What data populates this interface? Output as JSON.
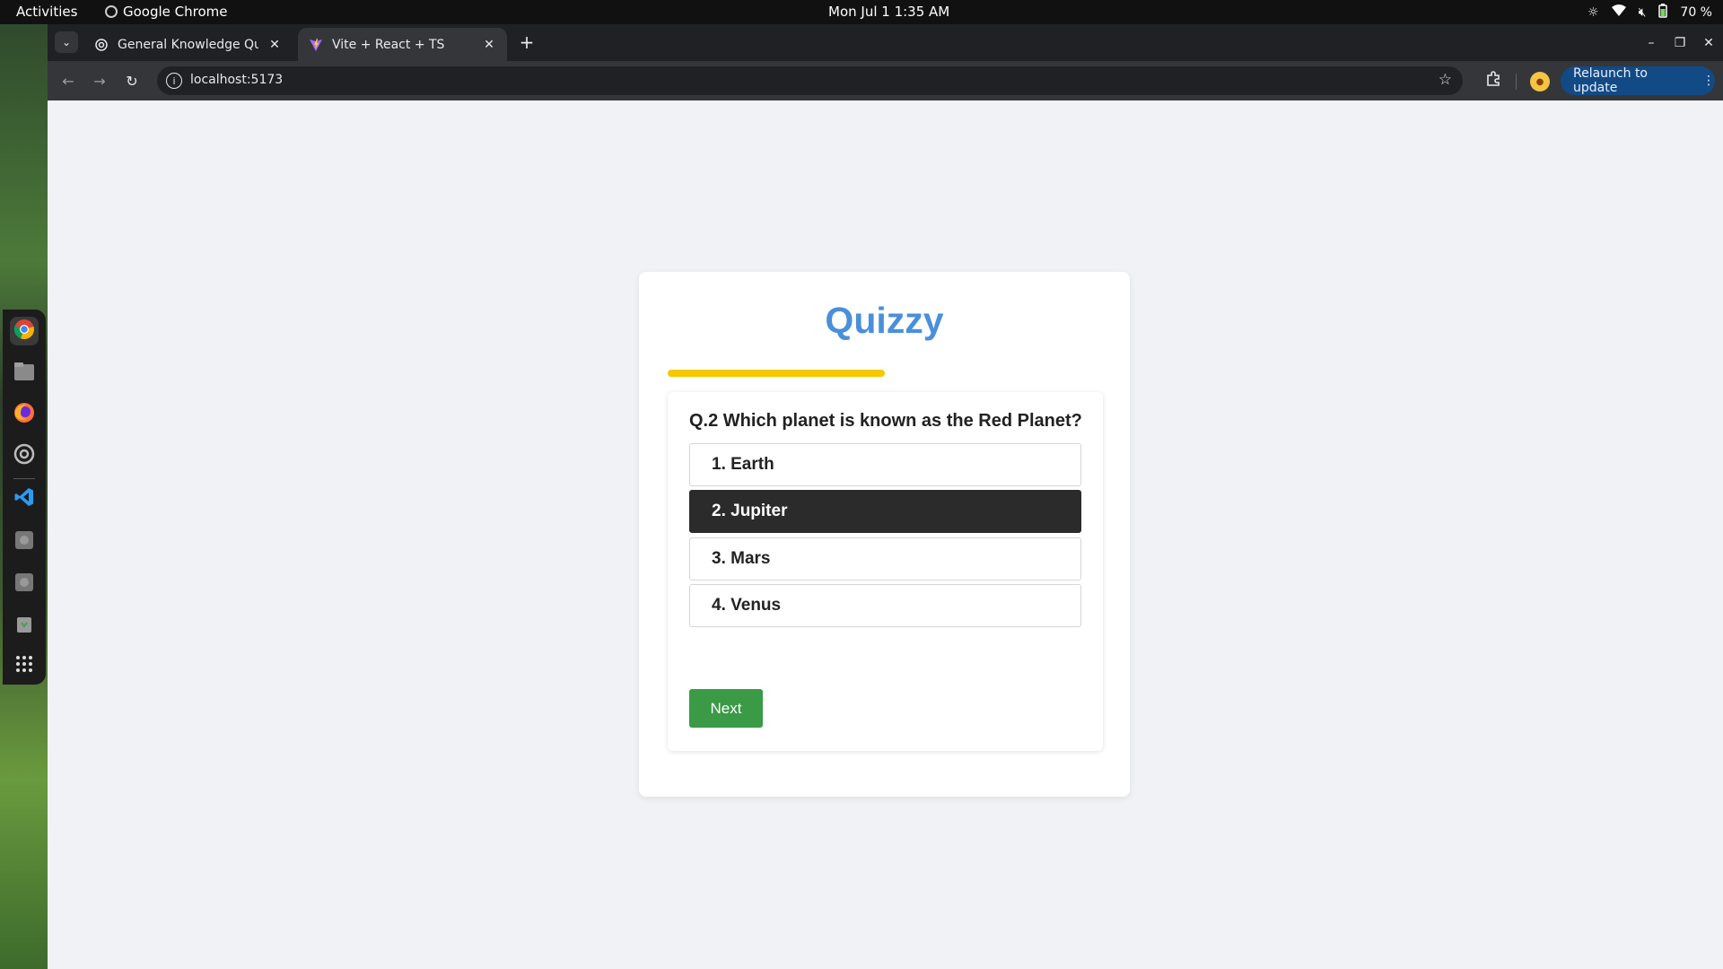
{
  "topbar": {
    "activities": "Activities",
    "app_name": "Google Chrome",
    "clock": "Mon Jul 1  1:35 AM",
    "battery": "70 %"
  },
  "dock": {
    "items": [
      "chrome-icon",
      "files-icon",
      "firefox-icon",
      "settings-icon",
      "vscode-icon",
      "disk-icon",
      "disk-icon",
      "trash-icon",
      "app-grid-icon"
    ]
  },
  "browser": {
    "tabs": [
      {
        "title": "General Knowledge Quiz",
        "active": false
      },
      {
        "title": "Vite + React + TS",
        "active": true
      }
    ],
    "url": "localhost:5173",
    "relaunch_label": "Relaunch to update"
  },
  "quiz": {
    "brand": "Quizzy",
    "progress": 0.5,
    "question": "Q.2 Which planet is known as the Red Planet?",
    "options": [
      {
        "label": "1. Earth",
        "selected": false
      },
      {
        "label": "2. Jupiter",
        "selected": true
      },
      {
        "label": "3. Mars",
        "selected": false
      },
      {
        "label": "4. Venus",
        "selected": false
      }
    ],
    "next_label": "Next"
  },
  "colors": {
    "brand": "#4a8fdb",
    "progress": "#f5c800",
    "selected_option": "#2b2b2b",
    "next_button": "#3a9a45",
    "relaunch_button": "#124a86"
  }
}
